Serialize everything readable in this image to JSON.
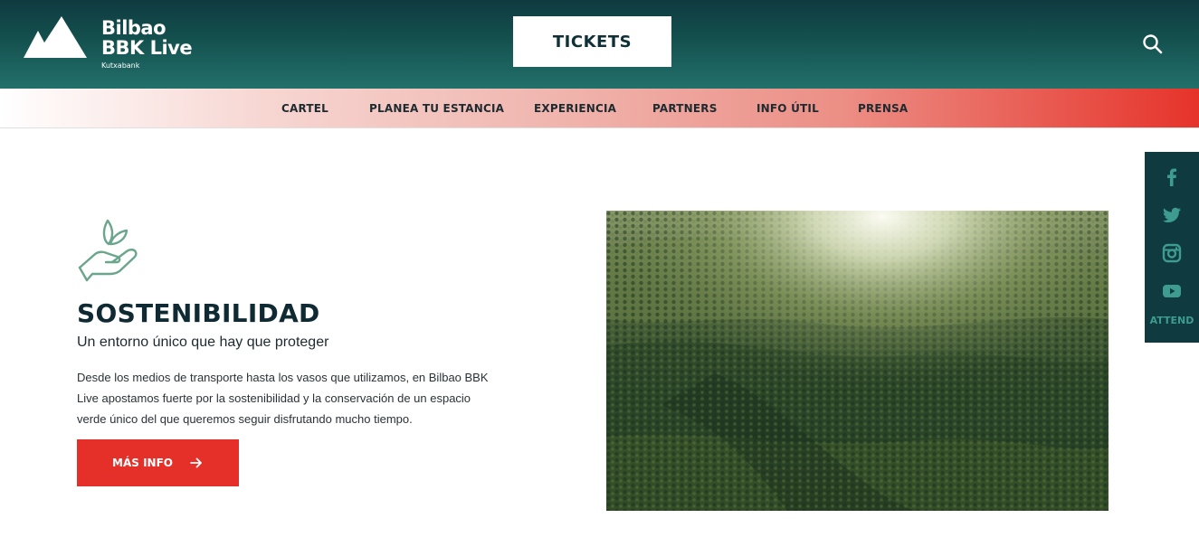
{
  "header": {
    "logo": {
      "line1": "Bilbao",
      "line2": "BBK Live",
      "sponsor": "Kutxabank"
    },
    "tickets_label": "TICKETS",
    "search_icon": "search-icon"
  },
  "nav": {
    "items": [
      {
        "label": "CARTEL"
      },
      {
        "label": "PLANEA TU ESTANCIA"
      },
      {
        "label": "EXPERIENCIA"
      },
      {
        "label": "PARTNERS"
      },
      {
        "label": "INFO ÚTIL"
      },
      {
        "label": "PRENSA"
      }
    ]
  },
  "social": {
    "icons": [
      "facebook-icon",
      "twitter-icon",
      "instagram-icon",
      "youtube-icon"
    ],
    "attend_label": "ATTEND"
  },
  "section": {
    "icon": "hand-leaf-icon",
    "title": "SOSTENIBILIDAD",
    "subtitle": "Un entorno único que hay que proteger",
    "description": "Desde los medios de transporte hasta los vasos que utilizamos, en Bilbao BBK Live apostamos fuerte por la sostenibilidad y la conservación de un espacio verde único del que queremos seguir disfrutando mucho tiempo.",
    "button_label": "MÁS INFO",
    "image": "forest-photo"
  },
  "colors": {
    "header_dark": "#0f3a3f",
    "header_teal": "#22706a",
    "accent_red": "#e5302a",
    "title_dark": "#0f2a33",
    "social_teal": "#3d9c8f",
    "icon_green": "#6aa58c"
  }
}
